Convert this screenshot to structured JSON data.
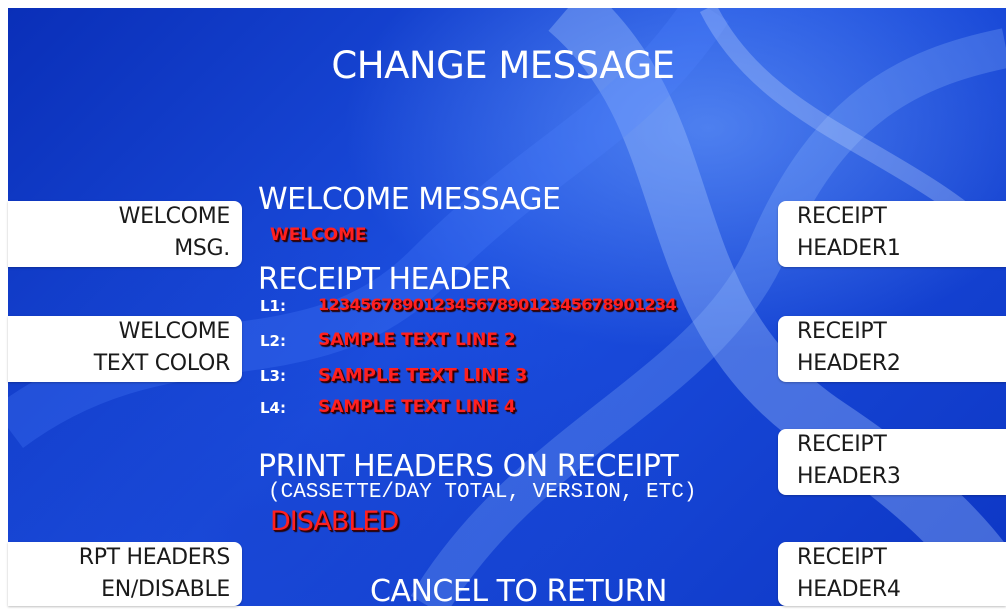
{
  "screen": {
    "title": "CHANGE MESSAGE",
    "footer": "CANCEL TO RETURN"
  },
  "left_buttons": [
    {
      "line1": "WELCOME",
      "line2": "MSG."
    },
    {
      "line1": "WELCOME",
      "line2": "TEXT COLOR"
    },
    {
      "line1": "RPT HEADERS",
      "line2": "EN/DISABLE"
    }
  ],
  "right_buttons": [
    {
      "line1": "RECEIPT",
      "line2": "HEADER1"
    },
    {
      "line1": "RECEIPT",
      "line2": "HEADER2"
    },
    {
      "line1": "RECEIPT",
      "line2": "HEADER3"
    },
    {
      "line1": "RECEIPT",
      "line2": "HEADER4"
    }
  ],
  "welcome": {
    "heading": "WELCOME MESSAGE",
    "value": "WELCOME"
  },
  "receipt_header": {
    "heading": "RECEIPT HEADER",
    "lines": [
      {
        "label": "L1:",
        "text": "1234567890123456789012345678901234"
      },
      {
        "label": "L2:",
        "text": "SAMPLE TEXT LINE 2"
      },
      {
        "label": "L3:",
        "text": "SAMPLE TEXT LINE 3"
      },
      {
        "label": "L4:",
        "text": "SAMPLE TEXT LINE 4"
      }
    ]
  },
  "print_headers": {
    "heading": "PRINT HEADERS ON RECEIPT",
    "subtext": "(CASSETTE/DAY TOTAL, VERSION, ETC)",
    "status": "DISABLED"
  },
  "colors": {
    "background": "#1c4fe0",
    "value_red": "#ff2020",
    "button_bg": "#ffffff"
  }
}
